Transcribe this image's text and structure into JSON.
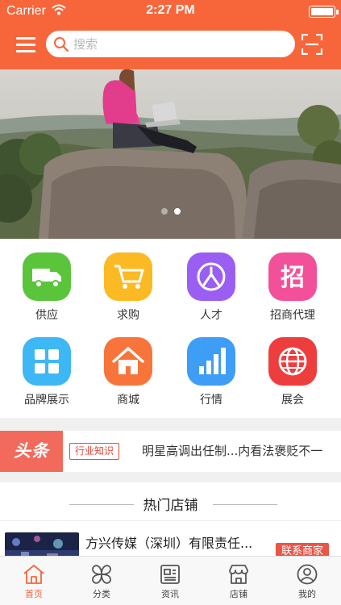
{
  "status_bar": {
    "carrier": "Carrier",
    "time": "2:27 PM"
  },
  "search": {
    "placeholder": "搜索",
    "value": ""
  },
  "banner": {
    "slide_count": 2,
    "active_slide": 2
  },
  "categories": [
    {
      "label": "供应",
      "icon": "truck-icon",
      "color": "#5ac53b"
    },
    {
      "label": "求购",
      "icon": "shopping-cart-icon",
      "color": "#fbb924"
    },
    {
      "label": "人才",
      "icon": "person-icon",
      "color": "#9a5ff2"
    },
    {
      "label": "招商代理",
      "icon": "zhao-char-icon",
      "color": "#f2519a"
    },
    {
      "label": "品牌展示",
      "icon": "grid-tiles-icon",
      "color": "#3eb7f5"
    },
    {
      "label": "商城",
      "icon": "home-icon",
      "color": "#f7753a"
    },
    {
      "label": "行情",
      "icon": "bar-chart-icon",
      "color": "#3e9df5"
    },
    {
      "label": "展会",
      "icon": "globe-icon",
      "color": "#ee3d3d"
    }
  ],
  "headline": {
    "brand": "头条",
    "tag": "行业知识",
    "text": "明星高调出任制...内看法褒贬不一"
  },
  "hot_shops": {
    "title": "热门店铺",
    "items": [
      {
        "name": "方兴传媒（深圳）有限责任...",
        "contact_label": "联系商家"
      }
    ]
  },
  "tabbar": [
    {
      "label": "首页",
      "icon": "home-outline-icon",
      "active": true
    },
    {
      "label": "分类",
      "icon": "clover-icon",
      "active": false
    },
    {
      "label": "资讯",
      "icon": "news-icon",
      "active": false
    },
    {
      "label": "店铺",
      "icon": "storefront-icon",
      "active": false
    },
    {
      "label": "我的",
      "icon": "user-icon",
      "active": false
    }
  ],
  "colors": {
    "accent": "#f7663a",
    "headline_brand": "#f26a5b",
    "contact_button": "#ea5548"
  }
}
